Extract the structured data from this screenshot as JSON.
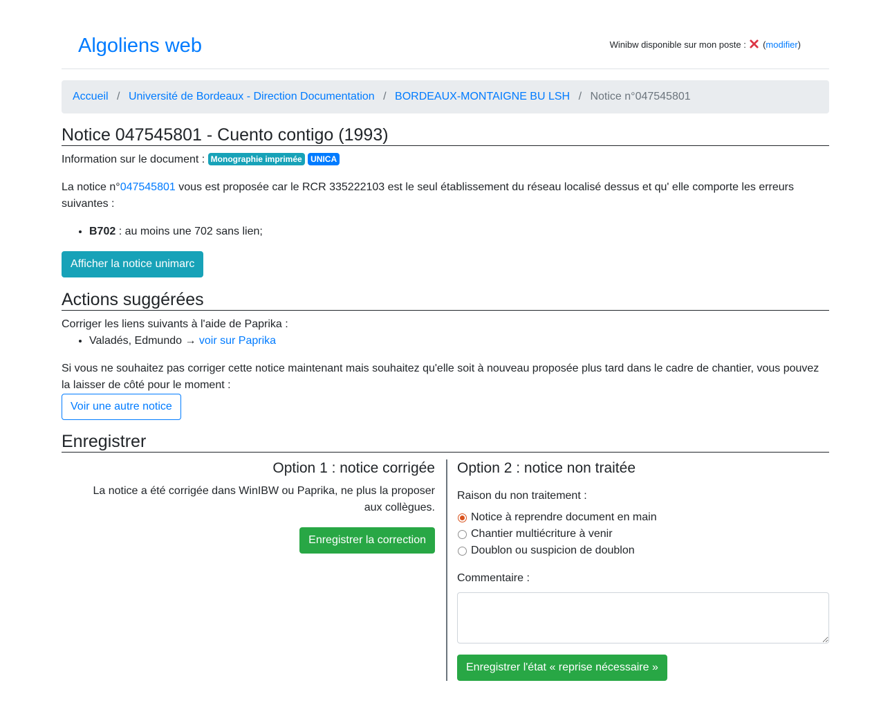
{
  "header": {
    "brand": "Algoliens web",
    "winibw_label": "Winibw disponible sur mon poste : ",
    "winibw_open": "(",
    "winibw_modify": "modifier",
    "winibw_close": ")",
    "winibw_status_icon": "cross-icon"
  },
  "breadcrumb": {
    "items": [
      "Accueil",
      "Université de Bordeaux - Direction Documentation",
      "BORDEAUX-MONTAIGNE BU LSH"
    ],
    "separator": "/",
    "active": "Notice n°047545801"
  },
  "notice": {
    "title": "Notice 047545801 - Cuento contigo (1993)",
    "info_label": "Information sur le document : ",
    "badges": [
      "Monographie imprimée",
      "UNICA"
    ],
    "desc_prefix": "La notice n°",
    "desc_link": "047545801",
    "desc_suffix": " vous est proposée car le RCR 335222103 est le seul établissement du réseau localisé dessus et qu' elle comporte les erreurs suivantes :",
    "errors": [
      {
        "code": "B702",
        "text": " : au moins une 702 sans lien;"
      }
    ],
    "unimarc_button": "Afficher la notice unimarc"
  },
  "actions": {
    "title": "Actions suggérées",
    "intro": "Corriger les liens suivants à l'aide de Paprika :",
    "links": [
      {
        "name": "Valadés, Edmundo",
        "arrow": " → ",
        "link_text": "voir sur Paprika"
      }
    ],
    "skip_text": "Si vous ne souhaitez pas corriger cette notice maintenant mais souhaitez qu'elle soit à nouveau proposée plus tard dans le cadre de chantier, vous pouvez la laisser de côté pour le moment :",
    "other_notice_button": "Voir une autre notice"
  },
  "save": {
    "title": "Enregistrer",
    "option1": {
      "title": "Option 1 : notice corrigée",
      "text": "La notice a été corrigée dans WinIBW ou Paprika, ne plus la proposer aux collègues.",
      "button": "Enregistrer la correction"
    },
    "option2": {
      "title": "Option 2 : notice non traitée",
      "reason_label": "Raison du non traitement :",
      "reasons": [
        {
          "label": "Notice à reprendre document en main",
          "checked": true
        },
        {
          "label": "Chantier multiécriture à venir",
          "checked": false
        },
        {
          "label": "Doublon ou suspicion de doublon",
          "checked": false
        }
      ],
      "comment_label": "Commentaire :",
      "comment_value": "",
      "button": "Enregistrer l'état « reprise nécessaire »"
    }
  },
  "colors": {
    "primary": "#007bff",
    "info": "#17a2b8",
    "success": "#28a745",
    "breadcrumb_bg": "#e9ecef",
    "error_cross": "#dc3545"
  }
}
